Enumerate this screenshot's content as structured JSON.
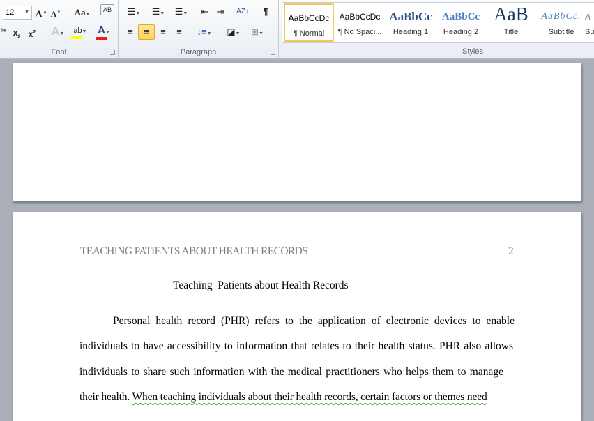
{
  "ribbon": {
    "font": {
      "label": "Font",
      "font_size": "12",
      "buttons": [
        "grow-font",
        "shrink-font",
        "change-case",
        "clear-formatting",
        "strikethrough",
        "subscript",
        "superscript",
        "text-effects",
        "highlight",
        "font-color"
      ],
      "highlight_color": "#ffff00",
      "font_color": "#e81c1c"
    },
    "paragraph": {
      "label": "Paragraph",
      "active_alignment": "center"
    },
    "styles": {
      "label": "Styles",
      "items": [
        {
          "preview": "AaBbCcDc",
          "name": "¶ Normal",
          "selected": true
        },
        {
          "preview": "AaBbCcDc",
          "name": "¶ No Spaci..."
        },
        {
          "preview": "AaBbCc",
          "name": "Heading 1"
        },
        {
          "preview": "AaBbCc",
          "name": "Heading 2"
        },
        {
          "preview": "AaB",
          "name": "Title"
        },
        {
          "preview": "AaBbCc.",
          "name": "Subtitle"
        },
        {
          "preview": "A",
          "name": "Su"
        }
      ]
    }
  },
  "document": {
    "header": {
      "running_head": "TEACHING PATIENTS ABOUT HEALTH RECORDS",
      "page_number": "2"
    },
    "title": "Teaching  Patients about Health Records",
    "lines": [
      "Personal health record (PHR) refers to the application of electronic devices to enable",
      "individuals to have accessibility to information that relates to their health status. PHR also allows",
      "individuals to share such information with the medical practitioners who helps them to manage"
    ],
    "last_line_start": "their health. ",
    "last_line_flagged": "When teaching individuals about their health records, certain factors or themes need"
  }
}
